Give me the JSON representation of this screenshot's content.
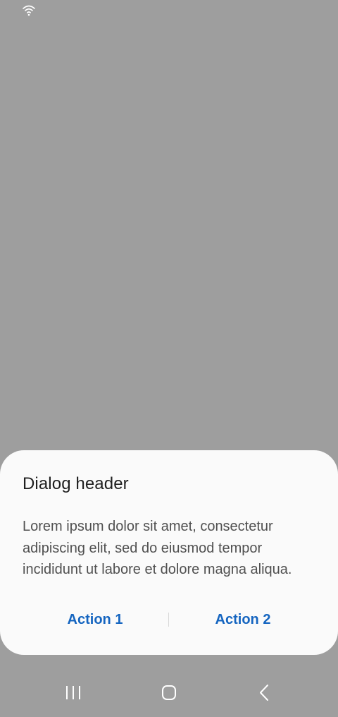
{
  "status_bar": {
    "wifi_icon": "wifi-icon"
  },
  "dialog": {
    "header": "Dialog header",
    "body": "Lorem ipsum dolor sit amet, consectetur adipiscing elit, sed do eiusmod tempor incididunt ut labore et dolore magna aliqua.",
    "actions": [
      {
        "label": "Action 1"
      },
      {
        "label": "Action 2"
      }
    ],
    "accent_color": "#1565c0",
    "background_color": "#fafafa"
  },
  "navigation_bar": {
    "recents_icon": "recents-icon",
    "home_icon": "home-icon",
    "back_icon": "back-icon"
  },
  "scrim_color": "#9e9e9e"
}
